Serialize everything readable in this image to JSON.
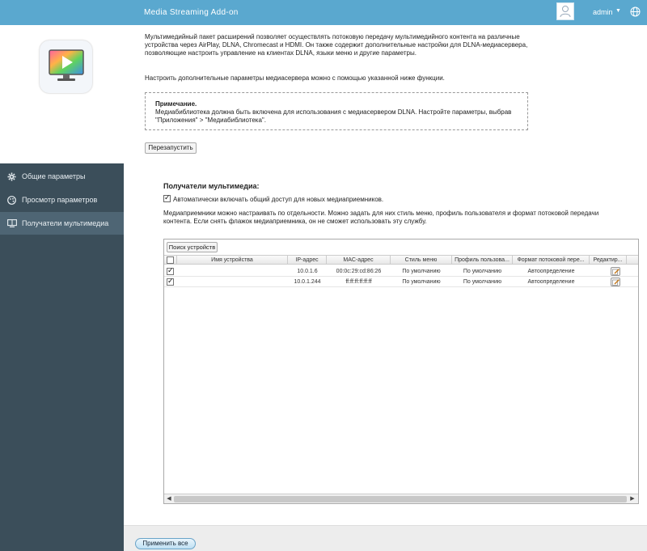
{
  "app": {
    "title": "Media Streaming Add-on",
    "user": "admin",
    "caret": "▼"
  },
  "header": {
    "description": "Мультимедийный пакет расширений позволяет осуществлять потоковую передачу мультимедийного контента на различные устройства через AirPlay, DLNA, Chromecast и HDMI. Он также содержит дополнительные настройки для DLNA-медиасервера, позволяющие настроить управление на клиентах DLNA, языки меню и другие параметры.",
    "description2": "Настроить дополнительные параметры медиасервера можно с помощью указанной ниже функции.",
    "note_title": "Примечание.",
    "note_text": "Медиабиблиотека должна быть включена для использования с медиасервером DLNA. Настройте параметры, выбрав \"Приложения\" > \"Медиабиблиотека\".",
    "restart_label": "Перезапустить"
  },
  "sidebar": {
    "items": [
      {
        "label": "Общие параметры",
        "icon": "gear-icon"
      },
      {
        "label": "Просмотр параметров",
        "icon": "palette-icon"
      },
      {
        "label": "Получатели мультимедиа",
        "icon": "media-receivers-icon"
      }
    ]
  },
  "main": {
    "section_title": "Получатели мультимедиа:",
    "auto_share_label": "Автоматически включать общий доступ для новых медиаприемников.",
    "info_text": "Медиаприемники можно настраивать по отдельности. Можно задать для них стиль меню, профиль пользователя и формат потоковой передачи контента. Если снять флажок медиаприемника, он не сможет использовать эту службу.",
    "scan_label": "Поиск устройств",
    "columns": [
      "Имя устройства",
      "IP-адрес",
      "MAC-адрес",
      "Стиль меню",
      "Профиль пользова...",
      "Формат потоковой пере...",
      "Редактир..."
    ],
    "rows": [
      {
        "name": "",
        "ip": "10.0.1.6",
        "mac": "00:0c:29:cd:86:26",
        "style": "По умолчанию",
        "profile": "По умолчанию",
        "format": "Автоопределение"
      },
      {
        "name": "",
        "ip": "10.0.1.244",
        "mac": "ff:ff:ff:ff:ff:ff",
        "style": "По умолчанию",
        "profile": "По умолчанию",
        "format": "Автоопределение"
      }
    ],
    "scroll_left": "◀",
    "scroll_right": "▶"
  },
  "footer": {
    "apply_label": "Применить все"
  },
  "colors": {
    "topbar": "#5aa8cf",
    "sidebar": "#3b4e5a",
    "sidebar_active": "#4e6574"
  }
}
